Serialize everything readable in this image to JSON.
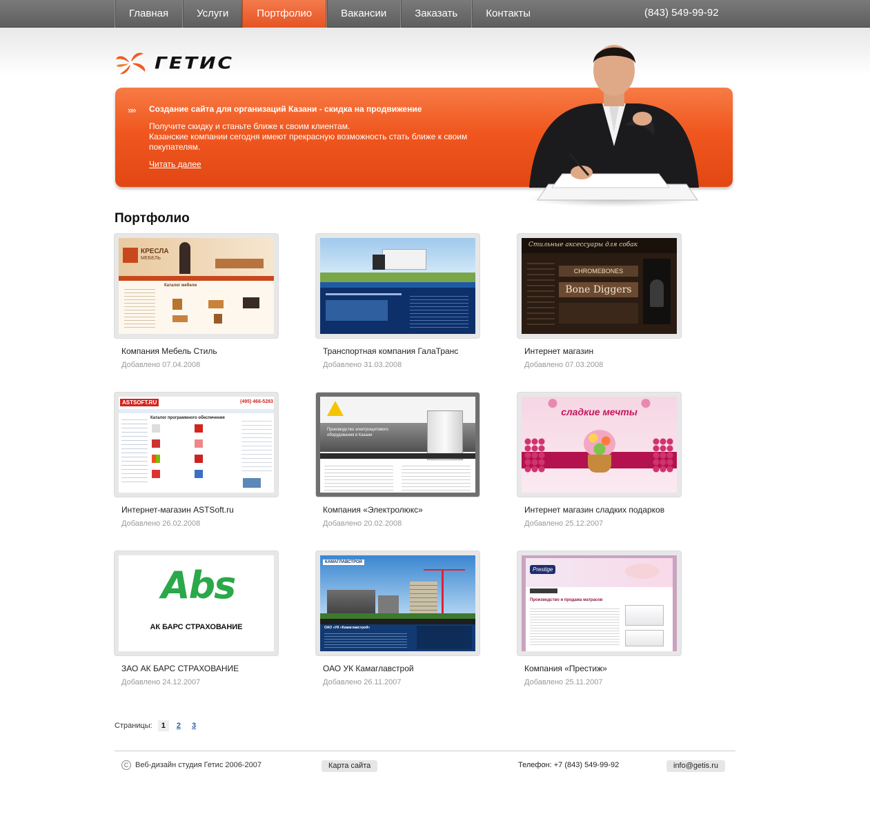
{
  "nav": {
    "items": [
      "Главная",
      "Услуги",
      "Портфолио",
      "Вакансии",
      "Заказать",
      "Контакты"
    ],
    "active": "Портфолио",
    "phone": "(843) 549-99-92"
  },
  "logo": {
    "text": "ГЕТИС"
  },
  "banner": {
    "title": "Создание сайта для организаций Казани - скидка на продвижение",
    "line1": "Получите скидку и станьте ближе к своим клиентам.",
    "line2": "Казанские компании сегодня имеют прекрасную возможность стать ближе к своим покупателям.",
    "link": "Читать далее"
  },
  "section_title": "Портфолио",
  "portfolio": [
    {
      "title": "Компания Мебель Стиль",
      "date": "Добавлено 07.04.2008"
    },
    {
      "title": "Транспортная компания ГалаТранс",
      "date": "Добавлено 31.03.2008"
    },
    {
      "title": "Интернет магазин",
      "date": "Добавлено 07.03.2008"
    },
    {
      "title": "Интернет-магазин ASTSoft.ru",
      "date": "Добавлено 26.02.2008"
    },
    {
      "title": "Компания «Электролюкс»",
      "date": "Добавлено 20.02.2008"
    },
    {
      "title": "Интернет магазин сладких подарков",
      "date": "Добавлено 25.12.2007"
    },
    {
      "title": "ЗАО АК БАРС СТРАХОВАНИЕ",
      "date": "Добавлено 24.12.2007"
    },
    {
      "title": "ОАО УК Камаглавстрой",
      "date": "Добавлено 26.11.2007"
    },
    {
      "title": "Компания «Престиж»",
      "date": "Добавлено 25.11.2007"
    }
  ],
  "thumbs": {
    "kresla": "КРЕСЛА",
    "kresla_sub": "МЕБЕЛЬ",
    "kresla_catalog": "Каталог мебели",
    "chromebones": "CHROMEBONES",
    "bonediggers": "Bone Diggers",
    "dogs_header": "Стильные аксессуары для собак",
    "astsoft": "ASTSOFT.RU",
    "astsoft_phone": "(495) 466-5283",
    "astsoft_catalog": "Каталог программного обеспечения",
    "electrolux_text": "Производство электрощитового оборудования в Казани",
    "sweet": "сладкие мечты",
    "absbig": "Abs",
    "absfull": "АК БАРС СТРАХОВАНИЕ",
    "kama": "КАМАГЛАВСТРОЙ",
    "kama_company": "ОАО «УК «Камаглавстрой»",
    "prestige": "Prestige",
    "prestige_head": "Производство и продажа матрасов"
  },
  "pager": {
    "label": "Страницы:",
    "pages": [
      "1",
      "2",
      "3"
    ]
  },
  "footer": {
    "copy_symbol": "C",
    "copyright": "Веб-дизайн студия Гетис 2006-2007",
    "sitemap": "Карта сайта",
    "phone": "Телефон: +7 (843) 549-99-92",
    "email": "info@getis.ru"
  }
}
